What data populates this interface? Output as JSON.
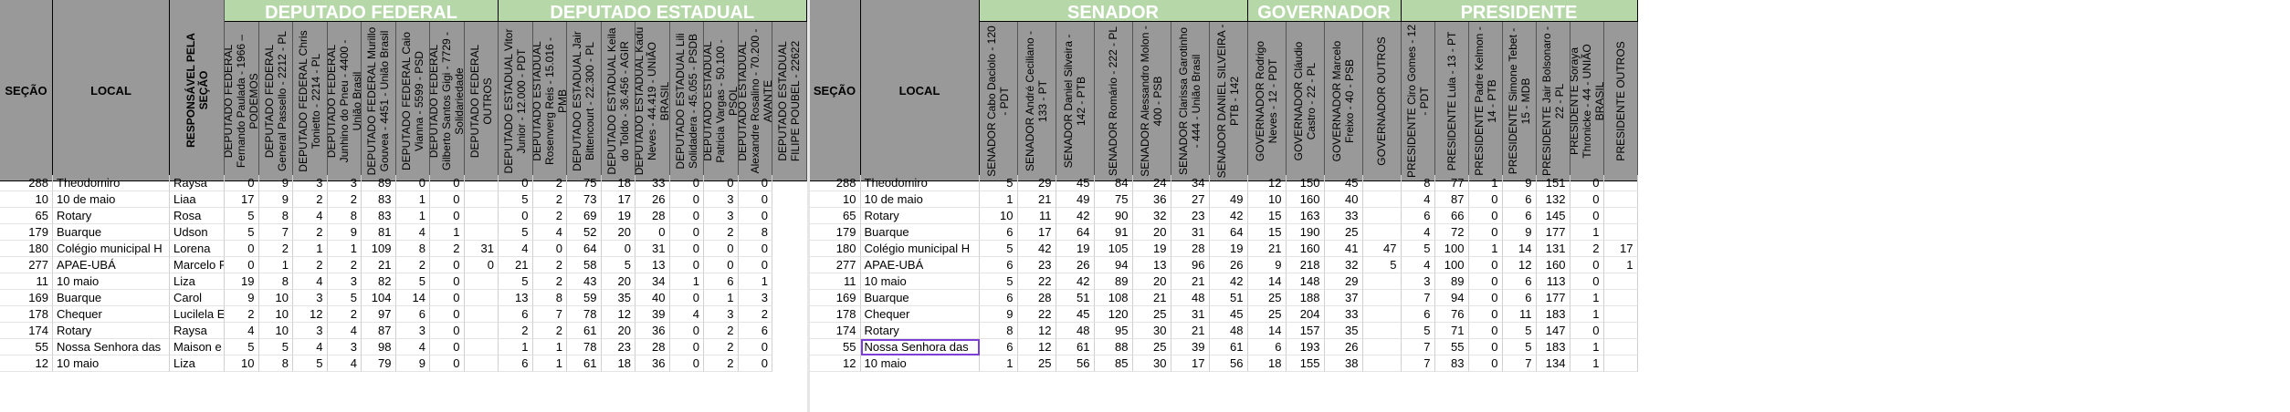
{
  "groups": {
    "dep_federal": "DEPUTADO FEDERAL",
    "dep_estadual": "DEPUTADO ESTADUAL",
    "senador": "SENADOR",
    "governador": "GOVERNADOR",
    "presidente": "PRESIDENTE"
  },
  "headers": {
    "secao": "SEÇÃO",
    "local": "LOCAL",
    "responsavel": "RESPONSÁVEL PELA SEÇÃO",
    "dep_federal": [
      "DEPUTADO FEDERAL Fernando Paulada - 1966 – PODEMOS",
      "DEPUTADO FEDERAL General Passello - 2212 - PL",
      "DEPUTADO FEDERAL Chris Tonietto - 2214 - PL",
      "DEPUTADO FEDERAL Junhino do Pneu - 4400 - União Brasil",
      "DEPUTADO FEDERAL Murillo Gouvea - 4451 - União Brasil",
      "DEPUTADO FEDERAL Caio Vianna - 5599 - PSD",
      "DEPUTADO FEDERAL Gilberto Santos Gigi - 7729 - Solidariedade",
      "DEPUTADO FEDERAL OUTROS"
    ],
    "dep_estadual": [
      "DEPUTADO ESTADUAL Vitor Junior - 12.000 - PDT",
      "DEPUTADO ESTADUAL Rosenverg Reis - 15.016 - PMB",
      "DEPUTADO ESTADUAL Jair Bittencourt - 22.300 - PL",
      "DEPUTADO ESTADUAL Keila do Toldo - 36.456 - AGIR",
      "DEPUTADO ESTADUAL Kadu Neves - 44.419 - UNIÃO BRASIL",
      "DEPUTADO ESTADUAL Lili Solidadera - 45.055 - PSDB",
      "DEPUTADO ESTADUAL Patricia Vargas - 50.100 - PSOL",
      "DEPUTADO ESTADUAL Alexandre Rosalino - 70.200 - AVANTE",
      "DEPUTADO ESTADUAL FILIPE POUBEL - 22622"
    ],
    "senador": [
      "SENADOR Cabo Daciolo - 120 - PDT",
      "SENADOR André Ceciliano - 133 - PT",
      "SENADOR Daniel Silveira - 142 - PTB",
      "SENADOR Romário - 222 - PL",
      "SENADOR Alessandro Molon - 400 - PSB",
      "SENADOR Clarissa Garotinho - 444 - União Brasil",
      "SENADOR DANIEL SILVEIRA - PTB - 142"
    ],
    "governador": [
      "GOVERNADOR Rodrigo Neves - 12 - PDT",
      "GOVERNADOR Cláudio Castro - 22 - PL",
      "GOVERNADOR Marcelo Freixo - 40 - PSB",
      "GOVERNADOR OUTROS"
    ],
    "presidente": [
      "PRESIDENTE Ciro Gomes - 12 - PDT",
      "PRESIDENTE Lula - 13 - PT",
      "PRESIDENTE Padre Kelmon - 14 - PTB",
      "PRESIDENTE Simone Tebet - 15 - MDB",
      "PRESIDENTE Jair Bolsonaro - 22 - PL",
      "PRESIDENTE Soraya Thronicke - 44 - UNIÃO BRASIL",
      "PRESIDENTE OUTROS"
    ]
  },
  "left_rows": [
    [
      "288",
      "Theodomiro",
      "Raysa",
      "0",
      "9",
      "3",
      "3",
      "89",
      "0",
      "0",
      "",
      "0",
      "2",
      "75",
      "18",
      "33",
      "0",
      "0",
      "0"
    ],
    [
      "10",
      "10 de maio",
      "Liaa",
      "17",
      "9",
      "2",
      "2",
      "83",
      "1",
      "0",
      "",
      "5",
      "2",
      "73",
      "17",
      "26",
      "0",
      "3",
      "0"
    ],
    [
      "65",
      "Rotary",
      "Rosa",
      "5",
      "8",
      "4",
      "8",
      "83",
      "1",
      "0",
      "",
      "0",
      "2",
      "69",
      "19",
      "28",
      "0",
      "3",
      "0"
    ],
    [
      "179",
      "Buarque",
      "Udson",
      "5",
      "7",
      "2",
      "9",
      "81",
      "4",
      "1",
      "",
      "5",
      "4",
      "52",
      "20",
      "0",
      "0",
      "2",
      "8"
    ],
    [
      "180",
      "Colégio municipal H",
      "Lorena",
      "0",
      "2",
      "1",
      "1",
      "109",
      "8",
      "2",
      "31",
      "4",
      "0",
      "64",
      "0",
      "31",
      "0",
      "0",
      "0"
    ],
    [
      "277",
      "APAE-UBÁ",
      "Marcelo F",
      "0",
      "1",
      "2",
      "2",
      "21",
      "2",
      "0",
      "0",
      "21",
      "2",
      "58",
      "5",
      "13",
      "0",
      "0",
      "0"
    ],
    [
      "11",
      "10 maio",
      "Liza",
      "19",
      "8",
      "4",
      "3",
      "82",
      "5",
      "0",
      "",
      "5",
      "2",
      "43",
      "20",
      "34",
      "1",
      "6",
      "1"
    ],
    [
      "169",
      "Buarque",
      "Carol",
      "9",
      "10",
      "3",
      "5",
      "104",
      "14",
      "0",
      "",
      "13",
      "8",
      "59",
      "35",
      "40",
      "0",
      "1",
      "3"
    ],
    [
      "178",
      "Chequer",
      "Lucilela E",
      "2",
      "10",
      "12",
      "2",
      "97",
      "6",
      "0",
      "",
      "6",
      "7",
      "78",
      "12",
      "39",
      "4",
      "3",
      "2"
    ],
    [
      "174",
      "Rotary",
      "Raysa",
      "4",
      "10",
      "3",
      "4",
      "87",
      "3",
      "0",
      "",
      "2",
      "2",
      "61",
      "20",
      "36",
      "0",
      "2",
      "6"
    ],
    [
      "55",
      "Nossa Senhora das",
      "Maison e",
      "5",
      "5",
      "4",
      "3",
      "98",
      "4",
      "0",
      "",
      "1",
      "1",
      "78",
      "23",
      "28",
      "0",
      "2",
      "0"
    ],
    [
      "12",
      "10 maio",
      "Liza",
      "10",
      "8",
      "5",
      "4",
      "79",
      "9",
      "0",
      "",
      "6",
      "1",
      "61",
      "18",
      "36",
      "0",
      "2",
      "0"
    ]
  ],
  "right_rows": [
    [
      "288",
      "Theodomiro",
      "5",
      "29",
      "45",
      "84",
      "24",
      "34",
      "",
      "12",
      "150",
      "45",
      "",
      "8",
      "77",
      "1",
      "9",
      "151",
      "0",
      ""
    ],
    [
      "10",
      "10 de maio",
      "1",
      "21",
      "49",
      "75",
      "36",
      "27",
      "49",
      "10",
      "160",
      "40",
      "",
      "4",
      "87",
      "0",
      "6",
      "132",
      "0",
      ""
    ],
    [
      "65",
      "Rotary",
      "10",
      "11",
      "42",
      "90",
      "32",
      "23",
      "42",
      "15",
      "163",
      "33",
      "",
      "6",
      "66",
      "0",
      "6",
      "145",
      "0",
      ""
    ],
    [
      "179",
      "Buarque",
      "6",
      "17",
      "64",
      "91",
      "20",
      "31",
      "64",
      "15",
      "190",
      "25",
      "",
      "4",
      "72",
      "0",
      "9",
      "177",
      "1",
      ""
    ],
    [
      "180",
      "Colégio municipal H",
      "5",
      "42",
      "19",
      "105",
      "19",
      "28",
      "19",
      "21",
      "160",
      "41",
      "47",
      "5",
      "100",
      "1",
      "14",
      "131",
      "2",
      "17"
    ],
    [
      "277",
      "APAE-UBÁ",
      "6",
      "23",
      "26",
      "94",
      "13",
      "96",
      "26",
      "9",
      "218",
      "32",
      "5",
      "4",
      "100",
      "0",
      "12",
      "160",
      "0",
      "1"
    ],
    [
      "11",
      "10 maio",
      "5",
      "22",
      "42",
      "89",
      "20",
      "21",
      "42",
      "14",
      "148",
      "29",
      "",
      "3",
      "89",
      "0",
      "6",
      "113",
      "0",
      ""
    ],
    [
      "169",
      "Buarque",
      "6",
      "28",
      "51",
      "108",
      "21",
      "48",
      "51",
      "25",
      "188",
      "37",
      "",
      "7",
      "94",
      "0",
      "6",
      "177",
      "1",
      ""
    ],
    [
      "178",
      "Chequer",
      "9",
      "22",
      "45",
      "120",
      "25",
      "31",
      "45",
      "25",
      "204",
      "33",
      "",
      "6",
      "76",
      "0",
      "11",
      "183",
      "1",
      ""
    ],
    [
      "174",
      "Rotary",
      "8",
      "12",
      "48",
      "95",
      "30",
      "21",
      "48",
      "14",
      "157",
      "35",
      "",
      "5",
      "71",
      "0",
      "5",
      "147",
      "0",
      ""
    ],
    [
      "55",
      "Nossa Senhora das",
      "6",
      "12",
      "61",
      "88",
      "25",
      "39",
      "61",
      "6",
      "193",
      "26",
      "",
      "7",
      "55",
      "0",
      "5",
      "183",
      "1",
      ""
    ],
    [
      "12",
      "10 maio",
      "1",
      "25",
      "56",
      "85",
      "30",
      "17",
      "56",
      "18",
      "155",
      "38",
      "",
      "7",
      "83",
      "0",
      "7",
      "134",
      "1",
      ""
    ]
  ]
}
